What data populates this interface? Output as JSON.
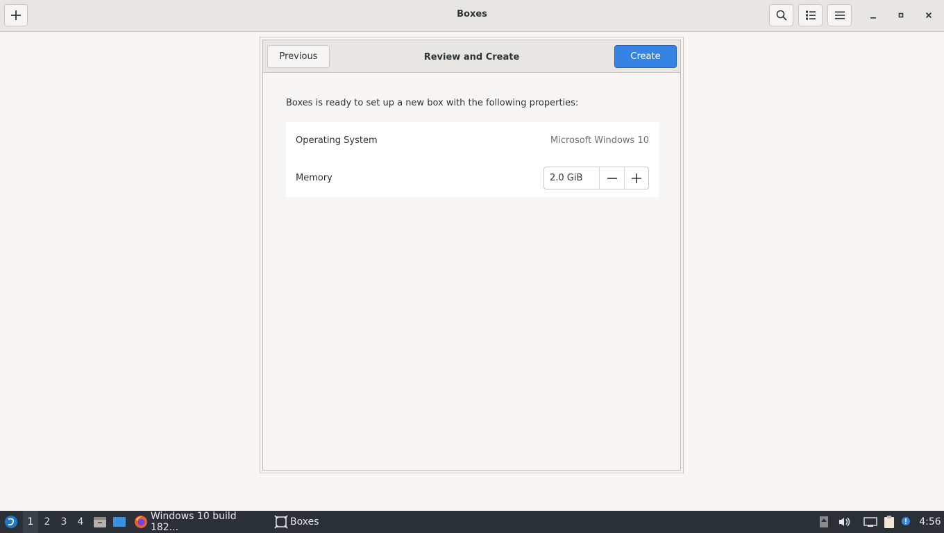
{
  "window": {
    "title": "Boxes",
    "new_button_icon": "plus-icon",
    "search_icon": "search-icon",
    "view_icon": "list-view-icon",
    "menu_icon": "hamburger-menu-icon",
    "minimize": "–",
    "maximize": "▫",
    "close": "✕"
  },
  "dialog": {
    "title": "Review and Create",
    "previous_label": "Previous",
    "create_label": "Create",
    "intro": "Boxes is ready to set up a new box with the following properties:",
    "properties": {
      "os_label": "Operating System",
      "os_value": "Microsoft Windows 10",
      "memory_label": "Memory",
      "memory_value": "2.0 GiB"
    },
    "accent_color": "#3584e4"
  },
  "taskbar": {
    "workspaces": [
      "1",
      "2",
      "3",
      "4"
    ],
    "active_workspace": "1",
    "tasks": [
      {
        "label": "Windows 10 build 182...",
        "icon": "firefox-icon"
      },
      {
        "label": "Boxes",
        "icon": "boxes-icon"
      }
    ],
    "clock": "4:56"
  }
}
